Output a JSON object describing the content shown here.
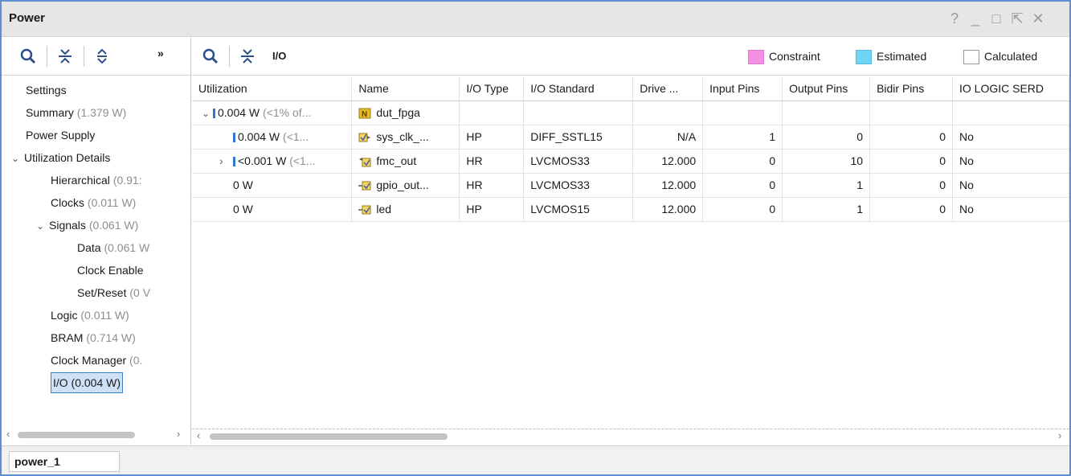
{
  "window": {
    "title": "Power",
    "controls": [
      "?",
      "_",
      "□",
      "⇱",
      "✕"
    ]
  },
  "left_toolbar": {
    "icons": [
      "search-icon",
      "collapse-all-icon",
      "expand-all-icon",
      "more-icon"
    ],
    "more_label": "»"
  },
  "tree": {
    "items": [
      {
        "label": "Settings",
        "detail": ""
      },
      {
        "label": "Summary",
        "detail": "(1.379 W)"
      },
      {
        "label": "Power Supply",
        "detail": ""
      },
      {
        "label": "Utilization Details",
        "detail": "",
        "chevron": "⌄"
      },
      {
        "label": "Hierarchical",
        "detail": "(0.91:"
      },
      {
        "label": "Clocks",
        "detail": "(0.011 W)"
      },
      {
        "label": "Signals",
        "detail": "(0.061 W)",
        "chevron": "⌄"
      },
      {
        "label": "Data",
        "detail": "(0.061 W"
      },
      {
        "label": "Clock Enable",
        "detail": ""
      },
      {
        "label": "Set/Reset",
        "detail": "(0 V"
      },
      {
        "label": "Logic",
        "detail": "(0.011 W)"
      },
      {
        "label": "BRAM",
        "detail": "(0.714 W)"
      },
      {
        "label": "Clock Manager",
        "detail": "(0."
      },
      {
        "label": "I/O (0.004 W)",
        "detail": ""
      }
    ]
  },
  "right_toolbar": {
    "title": "I/O"
  },
  "legend": {
    "constraint": {
      "label": "Constraint",
      "color": "#f48fe4"
    },
    "estimated": {
      "label": "Estimated",
      "color": "#6fd4f5"
    },
    "calculated": {
      "label": "Calculated",
      "color": "#ffffff"
    }
  },
  "table": {
    "columns": [
      "Utilization",
      "Name",
      "I/O Type",
      "I/O Standard",
      "Drive ...",
      "Input Pins",
      "Output Pins",
      "Bidir Pins",
      "IO LOGIC SERD"
    ],
    "rows": [
      {
        "chevron": "⌄",
        "util": "0.004 W",
        "util_dim": "(<1% of...",
        "icon": "chip-icon",
        "name": "dut_fpga",
        "type": "",
        "standard": "",
        "drive": "",
        "in": "",
        "out": "",
        "bidir": "",
        "serdes": ""
      },
      {
        "chevron": "",
        "util": "0.004 W",
        "util_dim": "(<1...",
        "icon": "diff-port-icon",
        "name": "sys_clk_...",
        "type": "HP",
        "standard": "DIFF_SSTL15",
        "drive": "N/A",
        "in": "1",
        "out": "0",
        "bidir": "0",
        "serdes": "No"
      },
      {
        "chevron": "›",
        "util": "<0.001 W",
        "util_dim": "(<1...",
        "icon": "bus-port-icon",
        "name": "fmc_out",
        "type": "HR",
        "standard": "LVCMOS33",
        "drive": "12.000",
        "in": "0",
        "out": "10",
        "bidir": "0",
        "serdes": "No"
      },
      {
        "chevron": "",
        "util": "0 W",
        "util_dim": "",
        "icon": "output-port-icon",
        "name": "gpio_out...",
        "type": "HR",
        "standard": "LVCMOS33",
        "drive": "12.000",
        "in": "0",
        "out": "1",
        "bidir": "0",
        "serdes": "No"
      },
      {
        "chevron": "",
        "util": "0 W",
        "util_dim": "",
        "icon": "output-port-icon",
        "name": "led",
        "type": "HP",
        "standard": "LVCMOS15",
        "drive": "12.000",
        "in": "0",
        "out": "1",
        "bidir": "0",
        "serdes": "No"
      }
    ]
  },
  "bottom": {
    "tab": "power_1"
  }
}
